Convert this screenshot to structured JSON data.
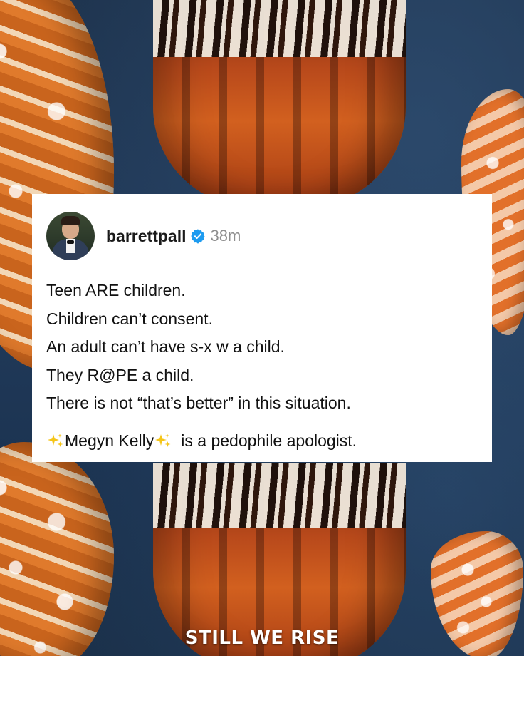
{
  "post": {
    "username": "barrettpall",
    "time": "38m",
    "lines": [
      "Teen ARE children.",
      "Children can’t consent.",
      "An adult can’t have s-x w a child.",
      "They R@PE a child.",
      "There is not “that’s better” in this situation."
    ],
    "last_line": {
      "name": "Megyn Kelly",
      "rest": "is a pedophile apologist."
    }
  },
  "caption": "STILL WE RISE",
  "icons": {
    "verified": "verified-badge-icon",
    "sparkles": "sparkles-icon"
  },
  "colors": {
    "verified": "#1d9bf0",
    "sparkles": "#f5c518",
    "username": "#1a1a1a",
    "time": "#8e8e8e"
  }
}
